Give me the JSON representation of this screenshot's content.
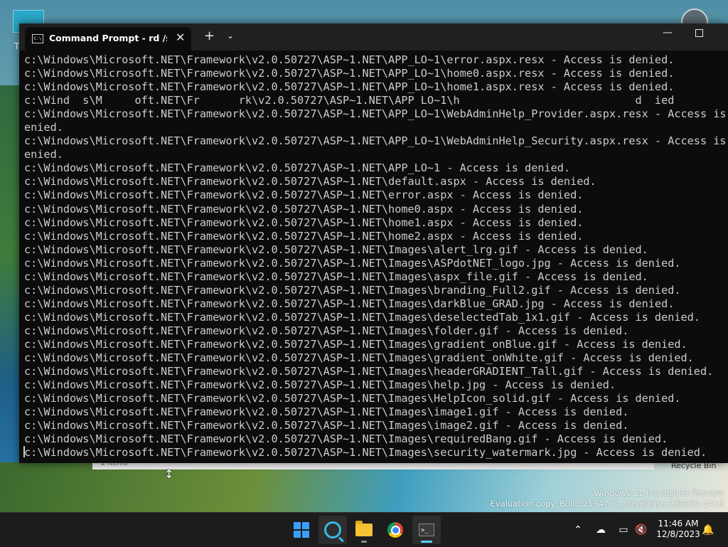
{
  "desktop": {
    "top_left_label": "T",
    "explorer_status": "2 items",
    "recycle_bin_label": "Recycle Bin",
    "watermark": {
      "line1": "Windows 11 Pro Insider Preview",
      "line2": "Evaluation copy. Build 25947.rs_prerelease.230901-1416"
    }
  },
  "terminal": {
    "tab_title": "Command Prompt - rd  /s /q c",
    "tab_close": "✕",
    "new_tab": "+",
    "dropdown": "⌄",
    "minimize": "—",
    "lines": [
      "c:\\Windows\\Microsoft.NET\\Framework\\v2.0.50727\\ASP~1.NET\\APP_LO~1\\error.aspx.resx - Access is denied.",
      "c:\\Windows\\Microsoft.NET\\Framework\\v2.0.50727\\ASP~1.NET\\APP_LO~1\\home0.aspx.resx - Access is denied.",
      "c:\\Windows\\Microsoft.NET\\Framework\\v2.0.50727\\ASP~1.NET\\APP_LO~1\\home1.aspx.resx - Access is denied.",
      "c:\\Wind  s\\M     oft.NET\\Fr      rk\\v2.0.50727\\ASP~1.NET\\APP LO~1\\h                           d  ied",
      "c:\\Windows\\Microsoft.NET\\Framework\\v2.0.50727\\ASP~1.NET\\APP_LO~1\\WebAdminHelp_Provider.aspx.resx - Access is d",
      "enied.",
      "c:\\Windows\\Microsoft.NET\\Framework\\v2.0.50727\\ASP~1.NET\\APP_LO~1\\WebAdminHelp_Security.aspx.resx - Access is d",
      "enied.",
      "c:\\Windows\\Microsoft.NET\\Framework\\v2.0.50727\\ASP~1.NET\\APP_LO~1 - Access is denied.",
      "c:\\Windows\\Microsoft.NET\\Framework\\v2.0.50727\\ASP~1.NET\\default.aspx - Access is denied.",
      "c:\\Windows\\Microsoft.NET\\Framework\\v2.0.50727\\ASP~1.NET\\error.aspx - Access is denied.",
      "c:\\Windows\\Microsoft.NET\\Framework\\v2.0.50727\\ASP~1.NET\\home0.aspx - Access is denied.",
      "c:\\Windows\\Microsoft.NET\\Framework\\v2.0.50727\\ASP~1.NET\\home1.aspx - Access is denied.",
      "c:\\Windows\\Microsoft.NET\\Framework\\v2.0.50727\\ASP~1.NET\\home2.aspx - Access is denied.",
      "c:\\Windows\\Microsoft.NET\\Framework\\v2.0.50727\\ASP~1.NET\\Images\\alert_lrg.gif - Access is denied.",
      "c:\\Windows\\Microsoft.NET\\Framework\\v2.0.50727\\ASP~1.NET\\Images\\ASPdotNET_logo.jpg - Access is denied.",
      "c:\\Windows\\Microsoft.NET\\Framework\\v2.0.50727\\ASP~1.NET\\Images\\aspx_file.gif - Access is denied.",
      "c:\\Windows\\Microsoft.NET\\Framework\\v2.0.50727\\ASP~1.NET\\Images\\branding_Full2.gif - Access is denied.",
      "c:\\Windows\\Microsoft.NET\\Framework\\v2.0.50727\\ASP~1.NET\\Images\\darkBlue_GRAD.jpg - Access is denied.",
      "c:\\Windows\\Microsoft.NET\\Framework\\v2.0.50727\\ASP~1.NET\\Images\\deselectedTab_1x1.gif - Access is denied.",
      "c:\\Windows\\Microsoft.NET\\Framework\\v2.0.50727\\ASP~1.NET\\Images\\folder.gif - Access is denied.",
      "c:\\Windows\\Microsoft.NET\\Framework\\v2.0.50727\\ASP~1.NET\\Images\\gradient_onBlue.gif - Access is denied.",
      "c:\\Windows\\Microsoft.NET\\Framework\\v2.0.50727\\ASP~1.NET\\Images\\gradient_onWhite.gif - Access is denied.",
      "c:\\Windows\\Microsoft.NET\\Framework\\v2.0.50727\\ASP~1.NET\\Images\\headerGRADIENT_Tall.gif - Access is denied.",
      "c:\\Windows\\Microsoft.NET\\Framework\\v2.0.50727\\ASP~1.NET\\Images\\help.jpg - Access is denied.",
      "c:\\Windows\\Microsoft.NET\\Framework\\v2.0.50727\\ASP~1.NET\\Images\\HelpIcon_solid.gif - Access is denied.",
      "c:\\Windows\\Microsoft.NET\\Framework\\v2.0.50727\\ASP~1.NET\\Images\\image1.gif - Access is denied.",
      "c:\\Windows\\Microsoft.NET\\Framework\\v2.0.50727\\ASP~1.NET\\Images\\image2.gif - Access is denied.",
      "c:\\Windows\\Microsoft.NET\\Framework\\v2.0.50727\\ASP~1.NET\\Images\\requiredBang.gif - Access is denied.",
      "c:\\Windows\\Microsoft.NET\\Framework\\v2.0.50727\\ASP~1.NET\\Images\\security_watermark.jpg - Access is denied."
    ]
  },
  "taskbar": {
    "icons": [
      "windows-start-icon",
      "search-icon",
      "file-explorer-icon",
      "chrome-icon",
      "terminal-icon"
    ],
    "tray": {
      "chevron": "⌃",
      "time": "11:46 AM",
      "date": "12/8/2023"
    }
  },
  "colors": {
    "terminal_bg": "#0c0c0c",
    "terminal_text": "#cccccc",
    "titlebar": "#202020",
    "taskbar": "#1c1c1c",
    "accent": "#60cdff"
  }
}
